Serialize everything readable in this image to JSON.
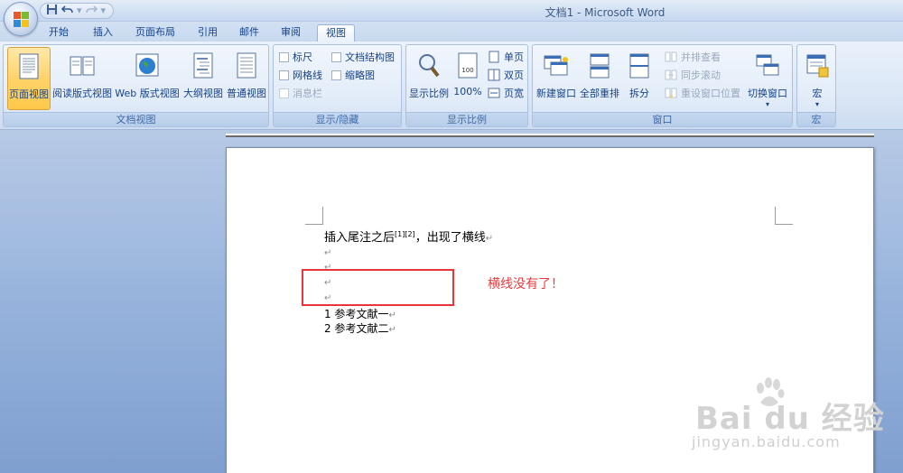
{
  "window": {
    "title": "文档1 - Microsoft Word"
  },
  "quick_access": {
    "items": [
      "save-icon",
      "undo-icon",
      "undo-dropdown-icon",
      "redo-icon",
      "customize-icon"
    ]
  },
  "tabs": [
    {
      "label": "开始",
      "active": false
    },
    {
      "label": "插入",
      "active": false
    },
    {
      "label": "页面布局",
      "active": false
    },
    {
      "label": "引用",
      "active": false
    },
    {
      "label": "邮件",
      "active": false
    },
    {
      "label": "审阅",
      "active": false
    },
    {
      "label": "视图",
      "active": true
    }
  ],
  "ribbon": {
    "document_views": {
      "label": "文档视图",
      "buttons": [
        "页面视图",
        "阅读版式视图",
        "Web 版式视图",
        "大纲视图",
        "普通视图"
      ],
      "selected": "页面视图"
    },
    "show_hide": {
      "label": "显示/隐藏",
      "items": [
        {
          "label": "标尺",
          "enabled": true
        },
        {
          "label": "文档结构图",
          "enabled": true
        },
        {
          "label": "网格线",
          "enabled": true
        },
        {
          "label": "缩略图",
          "enabled": true
        },
        {
          "label": "消息栏",
          "enabled": false
        }
      ]
    },
    "zoom": {
      "label": "显示比例",
      "buttons": [
        "显示比例",
        "100%"
      ],
      "small": [
        "单页",
        "双页",
        "页宽"
      ]
    },
    "window_group": {
      "label": "窗口",
      "buttons": [
        "新建窗口",
        "全部重排",
        "拆分"
      ],
      "small": [
        {
          "label": "并排查看",
          "enabled": false
        },
        {
          "label": "同步滚动",
          "enabled": false
        },
        {
          "label": "重设窗口位置",
          "enabled": false
        }
      ],
      "switch": "切换窗口"
    },
    "macros": {
      "label": "宏",
      "button": "宏"
    }
  },
  "document": {
    "line1_text": "插入尾注之后",
    "line1_sup": "[1][2]",
    "line1_rest": "，出现了横线",
    "para_mark": "↵",
    "endnotes": [
      "1  参考文献一",
      "2  参考文献二"
    ]
  },
  "annotation": {
    "text": "横线没有了！",
    "color": "#e8373b"
  },
  "watermark": {
    "brand": "Bai du 经验",
    "url": "jingyan.baidu.com"
  }
}
